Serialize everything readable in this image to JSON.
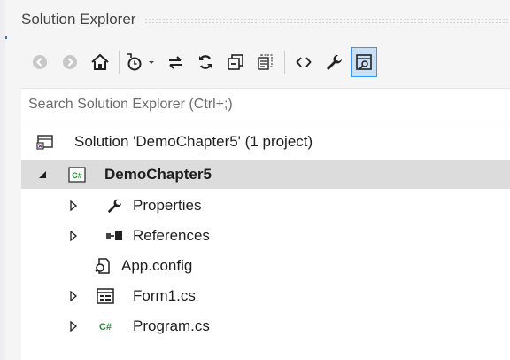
{
  "panel": {
    "title": "Solution Explorer",
    "accent_color": "#3399ff",
    "selection_color": "#dcdcdc"
  },
  "toolbar": {
    "buttons": [
      {
        "name": "back",
        "icon": "back-circle-icon"
      },
      {
        "name": "forward",
        "icon": "forward-circle-icon"
      },
      {
        "name": "home",
        "icon": "home-icon"
      },
      {
        "name": "pending-changes-filter",
        "icon": "clock-filter-icon"
      },
      {
        "name": "dropdown",
        "icon": "chevron-down-icon"
      },
      {
        "name": "sync-with-active-document",
        "icon": "sync-arrows-icon"
      },
      {
        "name": "refresh",
        "icon": "refresh-icon"
      },
      {
        "name": "collapse-all",
        "icon": "collapse-all-icon"
      },
      {
        "name": "show-all-files",
        "icon": "show-all-files-icon"
      },
      {
        "name": "view-code",
        "icon": "code-brackets-icon"
      },
      {
        "name": "properties",
        "icon": "wrench-icon"
      },
      {
        "name": "preview-selected-items",
        "icon": "preview-icon"
      }
    ]
  },
  "search": {
    "placeholder": "Search Solution Explorer (Ctrl+;)"
  },
  "tree": {
    "solution": {
      "label": "Solution 'DemoChapter5' (1 project)",
      "icon": "solution-icon"
    },
    "project": {
      "label": "DemoChapter5",
      "icon": "csharp-project-icon",
      "expanded": true,
      "selected": true
    },
    "items": [
      {
        "label": "Properties",
        "icon": "wrench-icon",
        "expandable": true
      },
      {
        "label": "References",
        "icon": "references-icon",
        "expandable": true
      },
      {
        "label": "App.config",
        "icon": "config-icon",
        "expandable": false
      },
      {
        "label": "Form1.cs",
        "icon": "form-icon",
        "expandable": true
      },
      {
        "label": "Program.cs",
        "icon": "csharp-file-icon",
        "expandable": true
      }
    ]
  }
}
